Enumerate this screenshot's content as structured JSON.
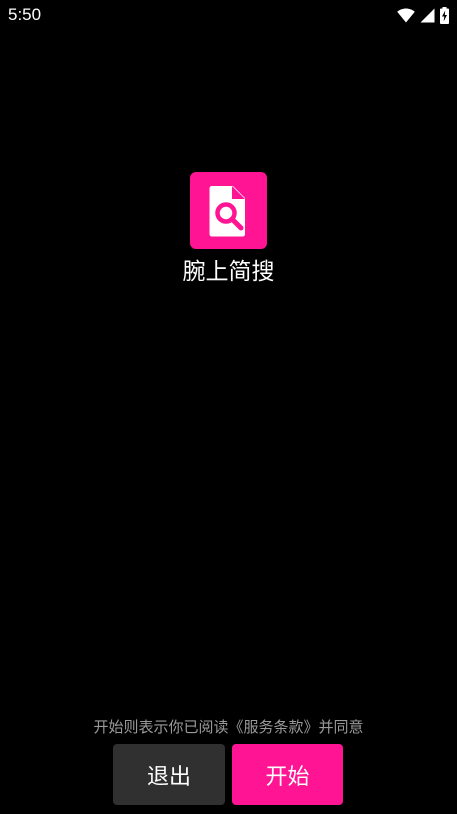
{
  "status_bar": {
    "time": "5:50",
    "icons": [
      "wifi-icon",
      "cellular-signal-icon",
      "battery-charging-icon"
    ]
  },
  "app": {
    "name": "腕上简搜",
    "logo_icon": "document-search-icon",
    "accent_color": "#ff1493"
  },
  "footer": {
    "terms_notice": "开始则表示你已阅读《服务条款》并同意",
    "exit_label": "退出",
    "start_label": "开始"
  },
  "colors": {
    "background": "#000000",
    "exit_button": "#303030",
    "start_button": "#ff1493",
    "notice_text": "#9a9a9a"
  }
}
